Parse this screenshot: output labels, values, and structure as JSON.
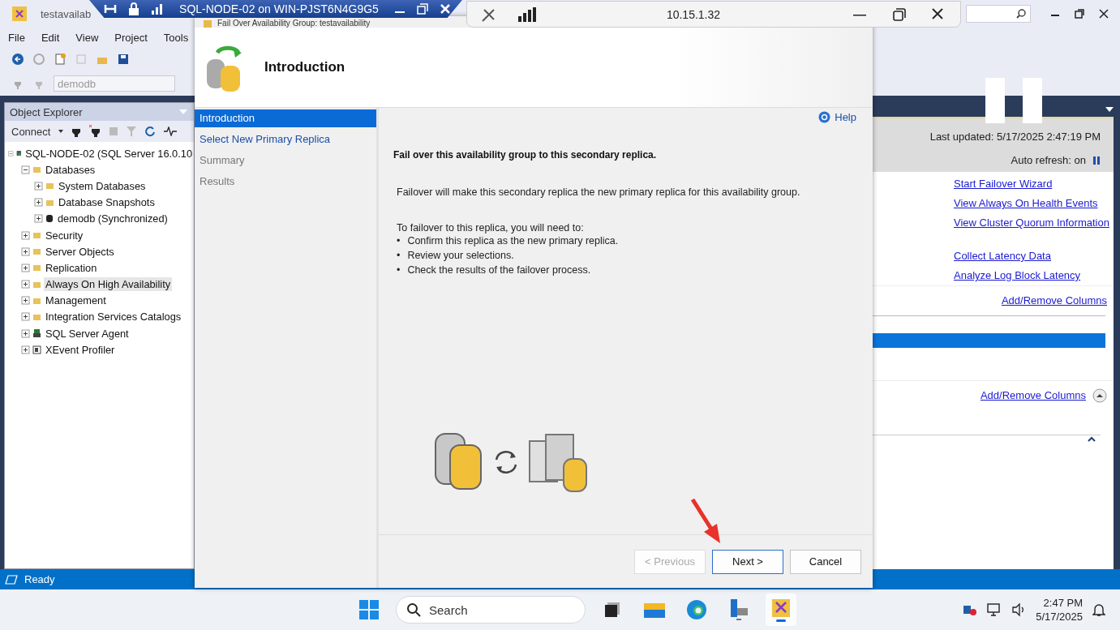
{
  "app": {
    "title": "testavailab",
    "menu": [
      "File",
      "Edit",
      "View",
      "Project",
      "Tools"
    ],
    "database_field": "demodb"
  },
  "rdp_bar": {
    "title": "SQL-NODE-02 on WIN-PJST6N4G9G5"
  },
  "remote_bar": {
    "address": "10.15.1.32"
  },
  "object_explorer": {
    "title": "Object Explorer",
    "connect": "Connect",
    "tree": [
      {
        "label": "SQL-NODE-02 (SQL Server 16.0.10",
        "kind": "server",
        "expanded": true,
        "selected": false,
        "children": [
          {
            "label": "Databases",
            "kind": "folder",
            "expanded": true,
            "selected": false,
            "children": [
              {
                "label": "System Databases",
                "kind": "folder",
                "expanded": false,
                "selected": false
              },
              {
                "label": "Database Snapshots",
                "kind": "folder",
                "expanded": false,
                "selected": false
              },
              {
                "label": "demodb (Synchronized)",
                "kind": "database",
                "expanded": false,
                "selected": false
              }
            ]
          },
          {
            "label": "Security",
            "kind": "folder",
            "expanded": false,
            "selected": false
          },
          {
            "label": "Server Objects",
            "kind": "folder",
            "expanded": false,
            "selected": false
          },
          {
            "label": "Replication",
            "kind": "folder",
            "expanded": false,
            "selected": false
          },
          {
            "label": "Always On High Availability",
            "kind": "folder",
            "expanded": false,
            "selected": true
          },
          {
            "label": "Management",
            "kind": "folder",
            "expanded": false,
            "selected": false
          },
          {
            "label": "Integration Services Catalogs",
            "kind": "folder",
            "expanded": false,
            "selected": false
          },
          {
            "label": "SQL Server Agent",
            "kind": "agent",
            "expanded": false,
            "selected": false
          },
          {
            "label": "XEvent Profiler",
            "kind": "profiler",
            "expanded": false,
            "selected": false
          }
        ]
      }
    ]
  },
  "dashboard": {
    "last_updated": "Last updated: 5/17/2025 2:47:19 PM",
    "auto_refresh": "Auto refresh: on",
    "link_groups": [
      [
        "Start Failover Wizard",
        "View Always On Health Events",
        "View Cluster Quorum Information"
      ],
      [
        "Collect Latency Data",
        "Analyze Log Block Latency"
      ]
    ],
    "add_remove_columns": [
      "Add/Remove Columns",
      "Add/Remove Columns"
    ],
    "rows": [
      {
        "selected": true
      }
    ]
  },
  "dialog": {
    "title": "Fail Over Availability Group: testavailability",
    "page_title": "Introduction",
    "help": "Help",
    "steps": [
      {
        "label": "Introduction",
        "selected": true,
        "enabled": true
      },
      {
        "label": "Select New Primary Replica",
        "selected": false,
        "enabled": true
      },
      {
        "label": "Summary",
        "selected": false,
        "enabled": false
      },
      {
        "label": "Results",
        "selected": false,
        "enabled": false
      }
    ],
    "heading": "Fail over this availability group to this secondary replica.",
    "paragraph": "Failover will make this secondary replica the new primary replica for this availability group.",
    "intro": "To failover to this replica, you will need to:",
    "bullets": [
      {
        "marker": "•",
        "text": "Confirm this replica as the new primary replica."
      },
      {
        "marker": "•",
        "text": "Review your selections."
      },
      {
        "marker": "•",
        "text": "Check the results of the failover process."
      }
    ],
    "buttons": [
      {
        "label": "< Previous",
        "disabled": true,
        "focused": false
      },
      {
        "label": "Next >",
        "disabled": false,
        "focused": true
      },
      {
        "label": "Cancel",
        "disabled": false,
        "focused": false
      }
    ]
  },
  "status_bar": {
    "text": "Ready"
  },
  "taskbar": {
    "search": "Search",
    "time": "2:47 PM",
    "date": "5/17/2025"
  }
}
